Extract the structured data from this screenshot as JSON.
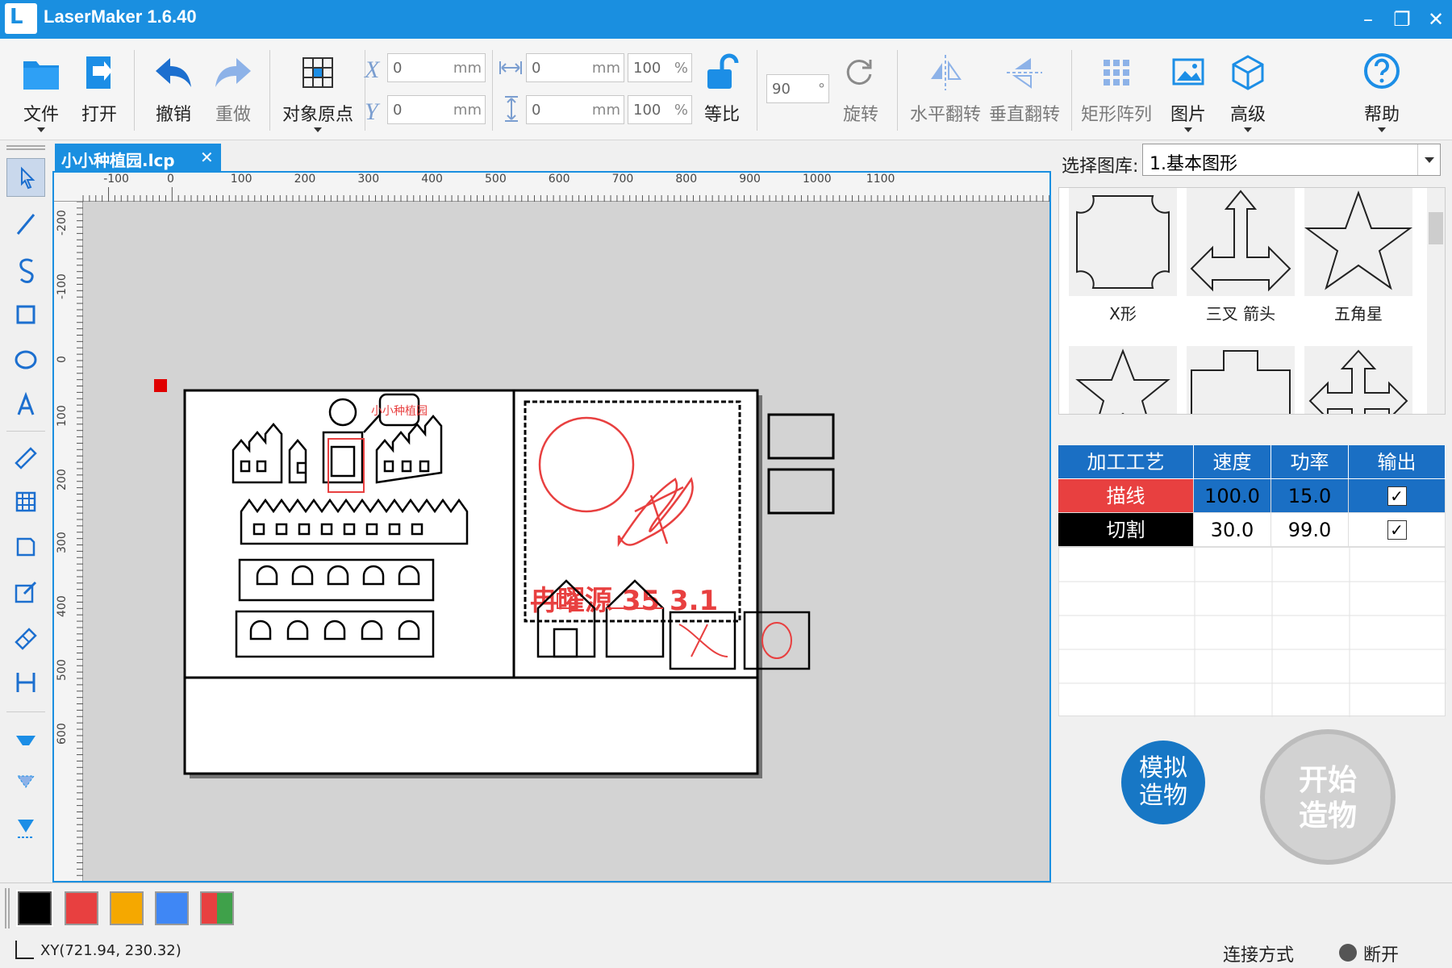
{
  "window": {
    "title": "LaserMaker 1.6.40",
    "logo_text": "L"
  },
  "toolbar": {
    "file": "文件",
    "open": "打开",
    "undo": "撤销",
    "redo": "重做",
    "origin": "对象原点",
    "x_label": "X",
    "y_label": "Y",
    "x_value": "0",
    "y_value": "0",
    "unit_mm": "mm",
    "width_value": "0",
    "height_value": "0",
    "scale_w": "100",
    "scale_h": "100",
    "unit_pct": "%",
    "ratio": "等比",
    "rotate_value": "90",
    "rotate_unit": "°",
    "rotate": "旋转",
    "hflip": "水平翻转",
    "vflip": "垂直翻转",
    "array": "矩形阵列",
    "image": "图片",
    "advanced": "高级",
    "help": "帮助"
  },
  "document": {
    "tab_name": "小小种植园.lcp",
    "close_glyph": "✕"
  },
  "rulers": {
    "h_labels": [
      "-100",
      "0",
      "100",
      "200",
      "300",
      "400",
      "500",
      "600",
      "700",
      "800",
      "900",
      "1000",
      "1100"
    ],
    "v_labels": [
      "-200",
      "-100",
      "0",
      "100",
      "200",
      "300",
      "400",
      "500",
      "600"
    ]
  },
  "design": {
    "stamp_text": "冉曜源 35 3.1",
    "sign_text": "小小种植园"
  },
  "library": {
    "label": "选择图库:",
    "selected": "1.基本图形",
    "shapes": [
      {
        "name": "X形"
      },
      {
        "name": "三叉 箭头"
      },
      {
        "name": "五角星"
      }
    ]
  },
  "process_table": {
    "headers": [
      "加工工艺",
      "速度",
      "功率",
      "输出"
    ],
    "rows": [
      {
        "name": "描线",
        "speed": "100.0",
        "power": "15.0",
        "output": true,
        "color": "#e84040"
      },
      {
        "name": "切割",
        "speed": "30.0",
        "power": "99.0",
        "output": false,
        "color": "#000000"
      }
    ]
  },
  "actions": {
    "simulate_line1": "模拟",
    "simulate_line2": "造物",
    "start_line1": "开始",
    "start_line2": "造物"
  },
  "palette": [
    "#000000",
    "#e84040",
    "#f5a800",
    "#3f87f5"
  ],
  "status": {
    "xy": "XY(721.94, 230.32)",
    "connection_label": "连接方式",
    "connection_state": "断开"
  }
}
